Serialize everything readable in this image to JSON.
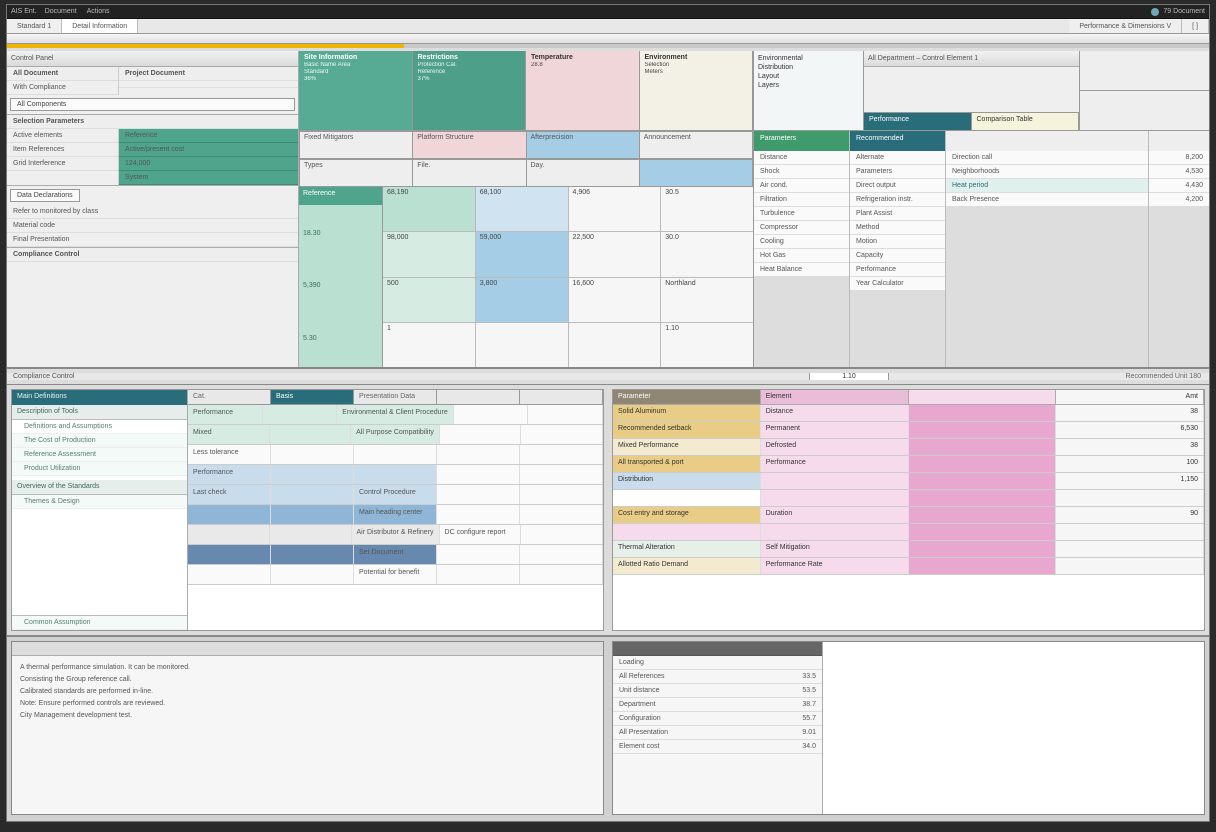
{
  "titlebar": {
    "app": "AIS Ent.",
    "menus": [
      "Document",
      "Actions"
    ],
    "right": "79 Document"
  },
  "tabs": {
    "left": [
      "Standard 1",
      "Detail Information"
    ],
    "right": [
      "Performance & Dimensions V",
      "[ ]"
    ]
  },
  "left_panel": {
    "head": "Control Panel",
    "pair_a": [
      "All Document",
      "Project Document"
    ],
    "pair_b": [
      "With Compliance",
      ""
    ],
    "btn": "All Components",
    "section1_h": "Selection Parameters",
    "section1": [
      "Active elements",
      "Item References",
      "Grid Interference"
    ],
    "section2_btn": "Data Declarations",
    "section2": [
      "Refer to monitored by class",
      "Material code",
      "Final Presentation"
    ],
    "section3_h": "Compliance Control",
    "teal_h": "Reference",
    "teal_v": [
      "Active/present cost",
      "124,000",
      "System"
    ]
  },
  "mid_cells": [
    {
      "h": "Site Information",
      "s": [
        "Basic Name Area",
        "Standard",
        "36%"
      ]
    },
    {
      "h": "Restrictions",
      "s": [
        "Protection Cal.",
        "Reference",
        "37%"
      ]
    },
    {
      "h": "Temperature",
      "s": [
        "",
        "",
        "28.8"
      ]
    },
    {
      "h": "Environment",
      "s": [
        "Selection",
        "Meters",
        ""
      ]
    }
  ],
  "gridband": [
    "Fixed Mitigators",
    "Platform Structure",
    "Afterprecision",
    "Announcement"
  ],
  "gridband2": [
    "Types",
    "File.",
    "Day.",
    ""
  ],
  "bigtable": {
    "side_h": "Reference",
    "side": [
      "18.30",
      "5,390",
      "5.30"
    ],
    "rows": [
      [
        "68,190",
        "68,100",
        "4,906",
        "30.5"
      ],
      [
        "98,000",
        "59,000",
        "22,500",
        "30.0"
      ],
      [
        "500",
        "3,800",
        "16,600",
        "Northland"
      ],
      [
        "1",
        "",
        "",
        "1.10"
      ]
    ]
  },
  "right_top": {
    "col": [
      "Environmental",
      "Distribution",
      "Layout",
      "Layers"
    ],
    "band_label": "All Department – Control Element 1",
    "band_tabs": [
      "Performance",
      "Comparison Table"
    ],
    "list_a_h": "Parameters",
    "list_a": [
      "Distance",
      "Shock",
      "Air cond.",
      "Filtration",
      "Turbulence",
      "Compressor",
      "Cooling",
      "Hot Gas",
      "Heat Balance"
    ],
    "list_b_h": "Recommended",
    "list_b": [
      "Alternate",
      "Parameters",
      "Direct output",
      "Refrigeration instr.",
      "Plant Assist",
      "Method",
      "Motion",
      "Capacity",
      "Performance",
      "Year Calculator"
    ],
    "list_c_h": "",
    "list_c": [
      "Direction call",
      "Neighborhoods",
      "Heat period",
      "Back Presence"
    ],
    "amt": [
      "8,200",
      "4,530",
      "4,430",
      "4,200"
    ]
  },
  "midbar": {
    "l": "Compliance Control",
    "c": "1.10",
    "r": "Recommended Unit 180"
  },
  "lower_left": {
    "nav_h": "Main Definitions",
    "nav_sub": "Description of Tools",
    "nav": [
      "Definitions and Assumptions",
      "The Cost of Production",
      "Reference Assessment",
      "Product Utilization"
    ],
    "nav_b": [
      "Overview of the Standards",
      "Themes & Design",
      "Common Assumption"
    ],
    "cols": [
      "Cat.",
      "Basis",
      "Presentation Data",
      "",
      ""
    ],
    "rows": [
      [
        "Performance",
        "",
        "Environmental & Client Procedure",
        "",
        ""
      ],
      [
        "Mixed",
        "",
        "All Purpose Compatibility",
        "",
        ""
      ],
      [
        "Less tolerance",
        "",
        "",
        "",
        ""
      ],
      [
        "Performance",
        "",
        "",
        "",
        ""
      ],
      [
        "Last check",
        "",
        "Control Procedure",
        "",
        ""
      ],
      [
        "",
        "",
        "Main heading center",
        "",
        ""
      ],
      [
        "",
        "",
        "Air Distributor & Refinery",
        "DC configure report",
        ""
      ],
      [
        "",
        "",
        "Set Document",
        "",
        ""
      ],
      [
        "",
        "",
        "Potential for benefit",
        "",
        ""
      ]
    ]
  },
  "lower_right": {
    "cols": [
      "Parameter",
      "Element",
      "",
      "Amt"
    ],
    "rows": [
      [
        "Solid Aluminum",
        "Distance",
        "",
        "38"
      ],
      [
        "Recommended setback",
        "Permanent",
        "",
        "6,530"
      ],
      [
        "Mixed Performance",
        "Defrosted",
        "",
        "38"
      ],
      [
        "All transported & port",
        "Performance",
        "",
        "100"
      ],
      [
        "Distribution",
        "",
        "",
        "1,150"
      ],
      [
        "",
        "",
        "",
        ""
      ],
      [
        "Cost entry and storage",
        "Duration",
        "",
        "90"
      ],
      [
        "",
        "",
        "",
        ""
      ],
      [
        "Thermal Alteration",
        "Self Mitigation",
        "",
        ""
      ],
      [
        "Allotted Ratio Demand",
        "Performance Rate",
        "",
        ""
      ]
    ],
    "row_colors": [
      "gold",
      "gold",
      "cream",
      "gold",
      "blue",
      "",
      "gold",
      "lpink",
      "ltgr",
      "cream"
    ]
  },
  "bottom_left": [
    "A thermal performance simulation. It can be monitored.",
    "Consisting the Group reference call.",
    "Calibrated standards are performed in-line.",
    "Note: Ensure performed controls are reviewed.",
    "City Management development test."
  ],
  "bottom_right": {
    "items": [
      [
        "Loading",
        ""
      ],
      [
        "All References",
        "33.5"
      ],
      [
        "Unit distance",
        "53.5"
      ],
      [
        "Department",
        "38.7"
      ],
      [
        "Configuration",
        "55.7"
      ],
      [
        "All Presentation",
        "9.01"
      ],
      [
        "Element cost",
        "34.0"
      ]
    ]
  }
}
